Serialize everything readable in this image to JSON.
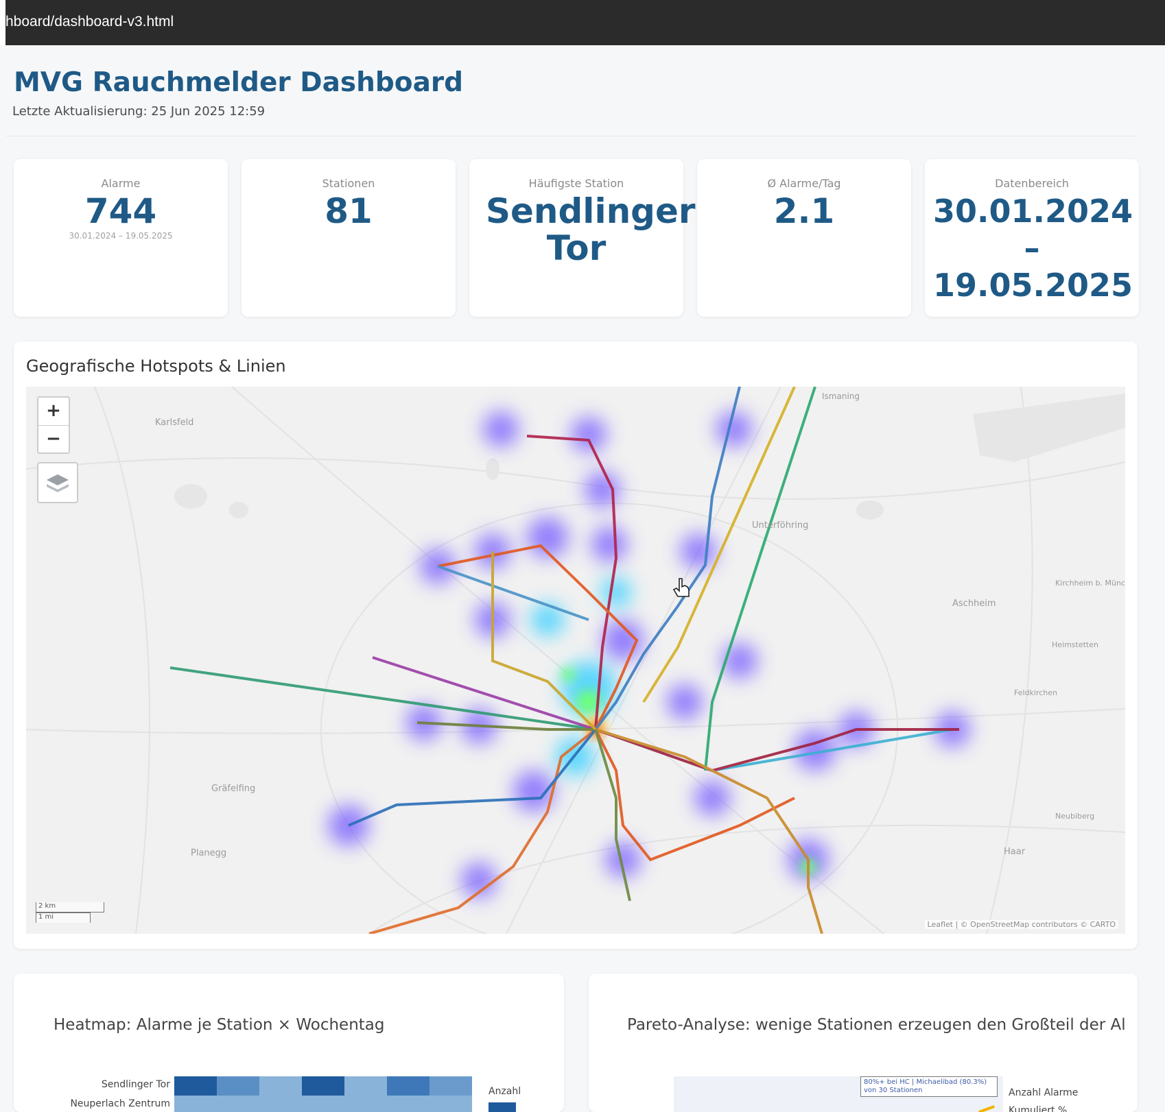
{
  "browser": {
    "url": "hboard/dashboard-v3.html"
  },
  "header": {
    "title": "MVG Rauchmelder Dashboard",
    "updated": "Letzte Aktualisierung: 25 Jun 2025 12:59"
  },
  "kpis": [
    {
      "label": "Alarme",
      "value": "744",
      "sub": "30.01.2024 – 19.05.2025"
    },
    {
      "label": "Stationen",
      "value": "81",
      "sub": ""
    },
    {
      "label": "Häufigste Station",
      "value": "Sendlinger Tor",
      "sub": ""
    },
    {
      "label": "Ø Alarme/Tag",
      "value": "2.1",
      "sub": ""
    },
    {
      "label": "Datenbereich",
      "value": "30.01.2024 – 19.05.2025",
      "sub": ""
    }
  ],
  "map": {
    "title": "Geografische Hotspots & Linien",
    "zoom_in": "+",
    "zoom_out": "−",
    "scale_km": "2 km",
    "scale_mi": "1 mi",
    "attribution": "Leaflet | © OpenStreetMap contributors © CARTO",
    "places": [
      "Karlsfeld",
      "Unterföhring",
      "Aschheim",
      "Kirchheim b. München",
      "Heimstetten",
      "Feldkirchen",
      "Gräfelfing",
      "Planegg",
      "Neubiberg",
      "Haar",
      "Ismaning"
    ]
  },
  "heatmap_card": {
    "title": "Heatmap: Alarme je Station × Wochentag",
    "rows": [
      "Sendlinger Tor",
      "Neuperlach Zentrum"
    ],
    "legend_label": "Anzahl",
    "colors": [
      "#1f5a9c",
      "#5a8fc5",
      "#8ab3d9",
      "#3e78b8"
    ]
  },
  "pareto_card": {
    "title": "Pareto-Analyse: wenige Stationen erzeugen den Großteil der Al",
    "annotation": "80%+ bei HC | Michaelibad (80.3%) von 30 Stationen",
    "legend": [
      "Anzahl Alarme",
      "Kumuliert %"
    ]
  },
  "colors": {
    "accent": "#1f5a86",
    "background": "#f6f7f9"
  }
}
